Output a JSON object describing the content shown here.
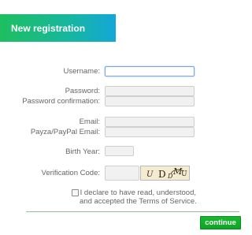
{
  "header": {
    "title": "New registration",
    "gradient_start": "#1dbf5f",
    "gradient_end": "#13a7d8"
  },
  "form": {
    "username_label": "Username:",
    "username_value": "",
    "password_label": "Password:",
    "password_value": "",
    "password_confirmation_label": "Password confirmation:",
    "password_confirmation_value": "",
    "email_label": "Email:",
    "email_value": "",
    "payza_email_label": "Payza/PayPal Email:",
    "payza_email_value": "",
    "birth_year_label": "Birth Year:",
    "birth_year_value": "",
    "verification_code_label": "Verification Code:",
    "verification_code_value": "",
    "captcha_text": "U D D MU"
  },
  "terms": {
    "checked": false,
    "line1": "I declare to have read, understood,",
    "line2": "and accepted the Terms of Service."
  },
  "actions": {
    "continue_label": "continue",
    "continue_color": "#14ad2b"
  }
}
